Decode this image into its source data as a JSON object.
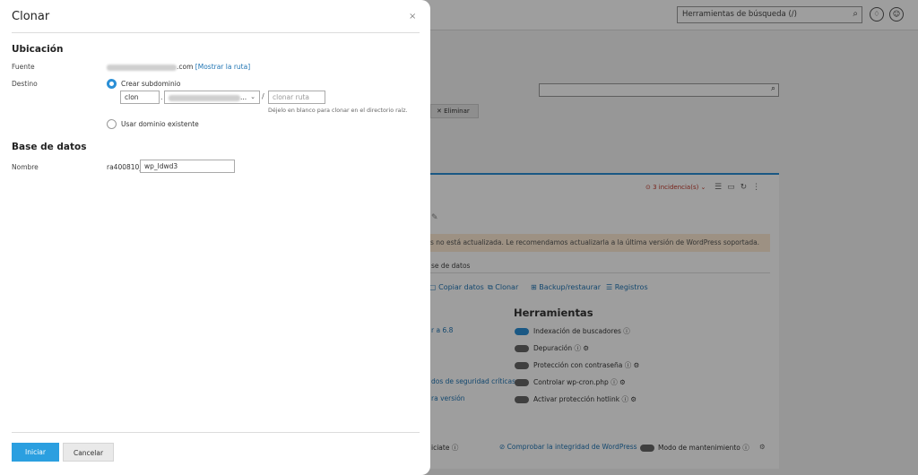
{
  "background": {
    "search_placeholder": "Herramientas de búsqueda (/)",
    "delete_label": "Eliminar",
    "incidents": "3 incidencia(s)",
    "warning": "s no está actualizada. Le recomendamos actualizarla a la última versión de WordPress soportada.",
    "db_heading": "se de datos",
    "actions": [
      "Copiar datos",
      "Clonar",
      "Backup/restaurar",
      "Registros"
    ],
    "tools_heading": "Herramientas",
    "left_links": [
      "r a 6.8",
      "dos de seguridad críticas",
      "ra versión"
    ],
    "tools": [
      {
        "label": "Indexación de buscadores",
        "on": true
      },
      {
        "label": "Depuración",
        "on": false
      },
      {
        "label": "Protección con contraseña",
        "on": false
      },
      {
        "label": "Controlar wp-cron.php",
        "on": false
      },
      {
        "label": "Activar protección hotlink",
        "on": false
      }
    ],
    "bottom_left": "iciate",
    "bottom_link": "Comprobar la integridad de WordPress",
    "bottom_toggle": "Modo de mantenimiento"
  },
  "modal": {
    "title": "Clonar",
    "close_icon": "×",
    "location_title": "Ubicación",
    "source_label": "Fuente",
    "source_suffix": ".com",
    "show_path_link": "[Mostrar la ruta]",
    "dest_label": "Destino",
    "create_subdomain_label": "Crear subdominio",
    "subdomain_value": "clon",
    "domain_suffix": "...",
    "dot": ".",
    "slash": "/",
    "path_placeholder": "clonar ruta",
    "hint": "Déjelo en blanco para clonar en el directorio raíz.",
    "use_existing_label": "Usar dominio existente",
    "db_title": "Base de datos",
    "name_label": "Nombre",
    "db_prefix": "ra400810_",
    "db_name_value": "wp_ldwd3",
    "start_button": "Iniciar",
    "cancel_button": "Cancelar"
  },
  "colors": {
    "accent": "#2b9fe0",
    "link": "#1f74b3"
  }
}
